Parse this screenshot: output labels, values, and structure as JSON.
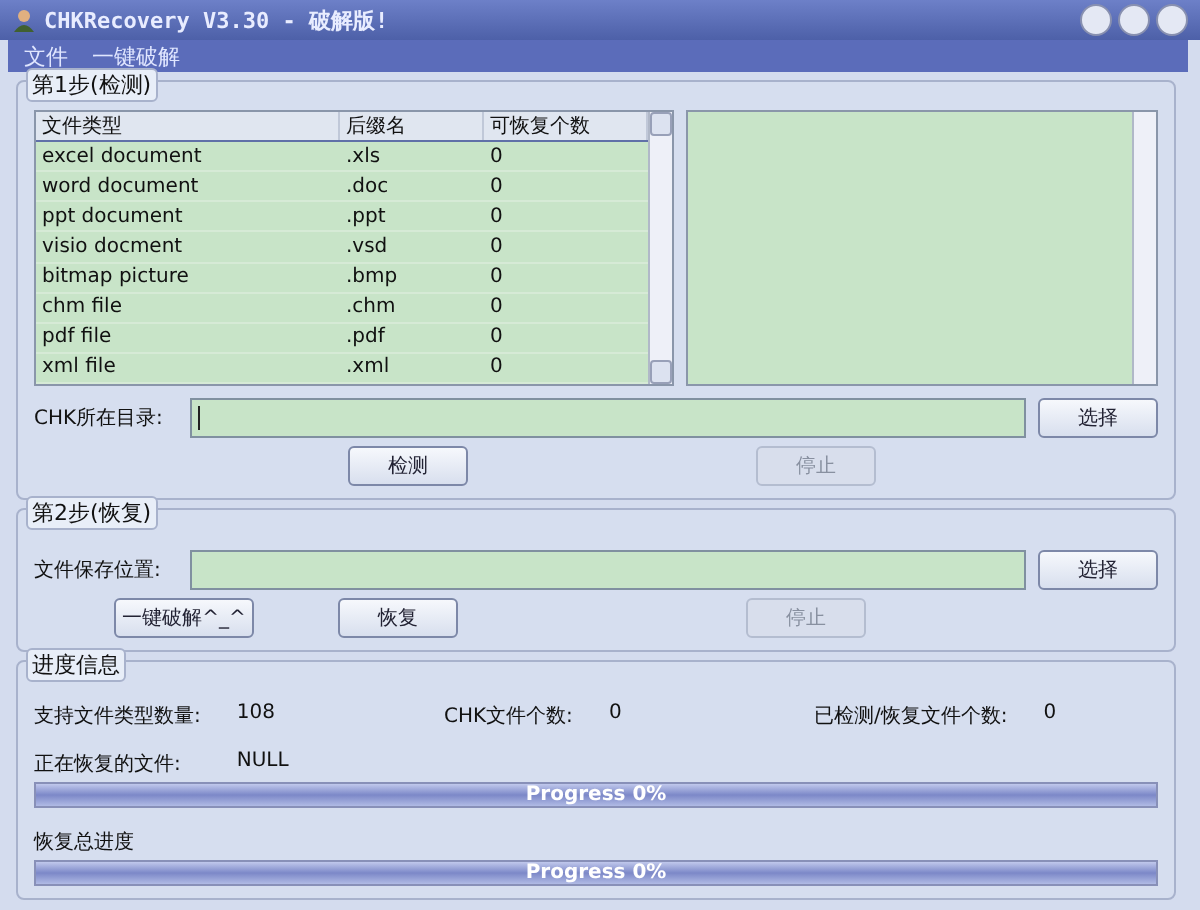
{
  "window": {
    "title": "CHKRecovery V3.30 - 破解版!"
  },
  "menu": [
    "文件",
    "一键破解"
  ],
  "step1": {
    "title": "第1步(检测)",
    "columns": [
      "文件类型",
      "后缀名",
      "可恢复个数"
    ],
    "rows": [
      {
        "type": "excel document",
        "ext": ".xls",
        "count": "0"
      },
      {
        "type": "word document",
        "ext": ".doc",
        "count": "0"
      },
      {
        "type": "ppt document",
        "ext": ".ppt",
        "count": "0"
      },
      {
        "type": "visio docment",
        "ext": ".vsd",
        "count": "0"
      },
      {
        "type": "bitmap picture",
        "ext": ".bmp",
        "count": "0"
      },
      {
        "type": "chm file",
        "ext": ".chm",
        "count": "0"
      },
      {
        "type": "pdf file",
        "ext": ".pdf",
        "count": "0"
      },
      {
        "type": "xml file",
        "ext": ".xml",
        "count": "0"
      }
    ],
    "dir_label": "CHK所在目录:",
    "browse": {
      "label": "选择",
      "disabled": false
    },
    "detect": {
      "label": "检测",
      "disabled": false
    },
    "stop": {
      "label": "停止",
      "disabled": true
    }
  },
  "step2": {
    "title": "第2步(恢复)",
    "dir_label": "文件保存位置:",
    "browse": {
      "label": "选择",
      "disabled": false
    },
    "crack": {
      "label": "一键破解^_^",
      "disabled": false
    },
    "recover": {
      "label": "恢复",
      "disabled": false
    },
    "stop": {
      "label": "停止",
      "disabled": true
    }
  },
  "progress": {
    "title": "进度信息",
    "stats": [
      {
        "label": "支持文件类型数量:",
        "value": "108"
      },
      {
        "label": "CHK文件个数:",
        "value": "0"
      },
      {
        "label": "已检测/恢复文件个数:",
        "value": "0"
      }
    ],
    "current_label": "正在恢复的文件:",
    "current_value": "NULL",
    "bars": [
      {
        "text": "Progress 0%",
        "level": 0
      },
      {
        "label": "恢复总进度",
        "text": "Progress 0%",
        "level": 0
      }
    ]
  }
}
